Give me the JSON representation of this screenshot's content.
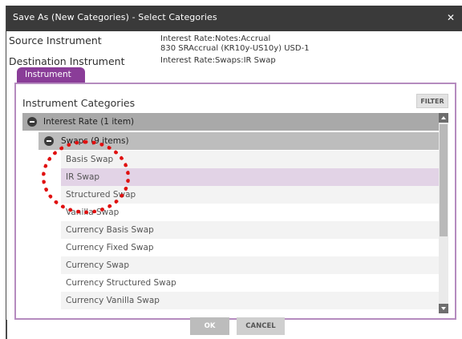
{
  "window": {
    "title": "Save As (New Categories) - Select Categories",
    "close_icon": "close-icon"
  },
  "info": {
    "source_label": "Source Instrument",
    "source_value_line1": "Interest Rate:Notes:Accrual",
    "source_value_line2": "830  SRAccrual (KR10y-US10y) USD-1",
    "destination_label": "Destination Instrument",
    "destination_value": "Interest Rate:Swaps:IR Swap"
  },
  "tab": {
    "label": "Instrument"
  },
  "panel": {
    "heading": "Instrument Categories",
    "filter_label": "FILTER"
  },
  "tree": {
    "root": "Interest Rate (1 item)",
    "group": "Swaps (9 items)",
    "items": [
      "Basis Swap",
      "IR Swap",
      "Structured Swap",
      "Vanilla Swap",
      "Currency Basis Swap",
      "Currency Fixed Swap",
      "Currency Swap",
      "Currency Structured Swap",
      "Currency Vanilla Swap"
    ],
    "selected_item": "IR Swap"
  },
  "buttons": {
    "ok": "OK",
    "cancel": "CANCEL"
  },
  "colors": {
    "titlebar": "#3a3a3a",
    "accent": "#8a3d98",
    "selected_row": "#e2d3e6",
    "annotation": "#e01010"
  }
}
